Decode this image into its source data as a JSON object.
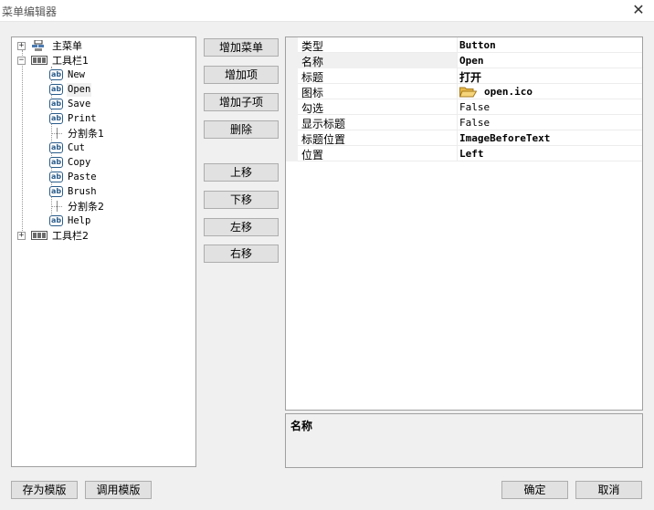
{
  "window": {
    "title": "菜单编辑器",
    "close_glyph": "✕"
  },
  "tree": {
    "items": [
      {
        "label": "主菜单",
        "icon": "menu-icon",
        "expander": "+"
      },
      {
        "label": "工具栏1",
        "icon": "toolbar-icon",
        "expander": "−"
      },
      {
        "label": "New",
        "icon": "ab-icon"
      },
      {
        "label": "Open",
        "icon": "ab-icon"
      },
      {
        "label": "Save",
        "icon": "ab-icon"
      },
      {
        "label": "Print",
        "icon": "ab-icon"
      },
      {
        "label": "分割条1",
        "icon": "separator-icon"
      },
      {
        "label": "Cut",
        "icon": "ab-icon"
      },
      {
        "label": "Copy",
        "icon": "ab-icon"
      },
      {
        "label": "Paste",
        "icon": "ab-icon"
      },
      {
        "label": "Brush",
        "icon": "ab-icon"
      },
      {
        "label": "分割条2",
        "icon": "separator-icon"
      },
      {
        "label": "Help",
        "icon": "ab-icon"
      },
      {
        "label": "工具栏2",
        "icon": "toolbar-icon",
        "expander": "+"
      }
    ],
    "ab_glyph": "ab"
  },
  "buttons": {
    "add_menu": "增加菜单",
    "add_item": "增加项",
    "add_subitem": "增加子项",
    "delete": "删除",
    "move_up": "上移",
    "move_down": "下移",
    "move_left": "左移",
    "move_right": "右移",
    "save_template": "存为模版",
    "load_template": "调用模版",
    "ok": "确定",
    "cancel": "取消"
  },
  "properties": [
    {
      "name": "类型",
      "value": "Button"
    },
    {
      "name": "名称",
      "value": "Open"
    },
    {
      "name": "标题",
      "value": "打开"
    },
    {
      "name": "图标",
      "value": "open.ico",
      "icon": "folder-open-icon"
    },
    {
      "name": "勾选",
      "value": "False"
    },
    {
      "name": "显示标题",
      "value": "False"
    },
    {
      "name": "标题位置",
      "value": "ImageBeforeText"
    },
    {
      "name": "位置",
      "value": "Left"
    }
  ],
  "description": {
    "title": "名称"
  }
}
